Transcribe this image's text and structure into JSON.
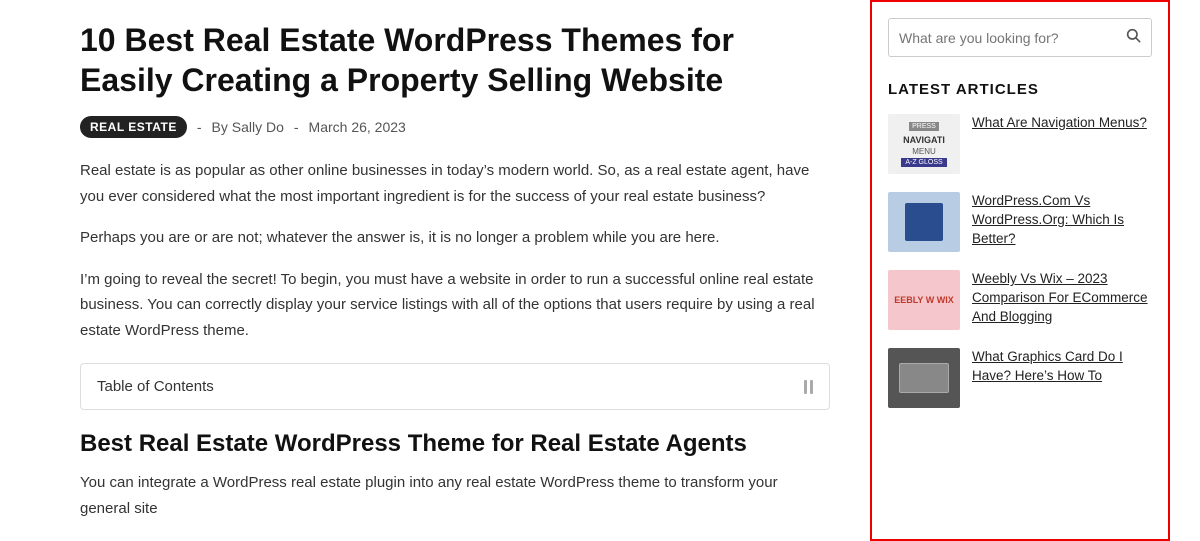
{
  "main": {
    "title": "10 Best Real Estate WordPress Themes for Easily Creating a Property Selling Website",
    "tag": "REAL ESTATE",
    "author": "By Sally Do",
    "date": "March 26, 2023",
    "separator1": "-",
    "separator2": "-",
    "paragraphs": [
      "Real estate is as popular as other online businesses in today’s modern world. So, as a real estate agent, have you ever considered what the most important ingredient is for the success of your real estate business?",
      "Perhaps you are or are not; whatever the answer is, it is no longer a problem while you are here.",
      "I’m going to reveal the secret! To begin, you must have a website in order to run a successful online real estate business. You can correctly display your service listings with all of the options that users require by using a real estate WordPress theme."
    ],
    "toc_label": "Table of Contents",
    "section_title": "Best Real Estate WordPress Theme for Real Estate Agents",
    "section_body": "You can integrate a WordPress real estate plugin into any real estate WordPress theme to transform your general site"
  },
  "sidebar": {
    "search_placeholder": "What are you looking for?",
    "latest_articles_title": "LATEST ARTICLES",
    "articles": [
      {
        "title": "What Are Navigation Menus?",
        "thumb_type": "press"
      },
      {
        "title": "WordPress.Com Vs WordPress.Org: Which Is Better?",
        "thumb_type": "wp"
      },
      {
        "title": "Weebly Vs Wix – 2023 Comparison For ECommerce And Blogging",
        "thumb_type": "weebly"
      },
      {
        "title": "What Graphics Card Do I Have? Here’s How To",
        "thumb_type": "gpu"
      }
    ]
  }
}
